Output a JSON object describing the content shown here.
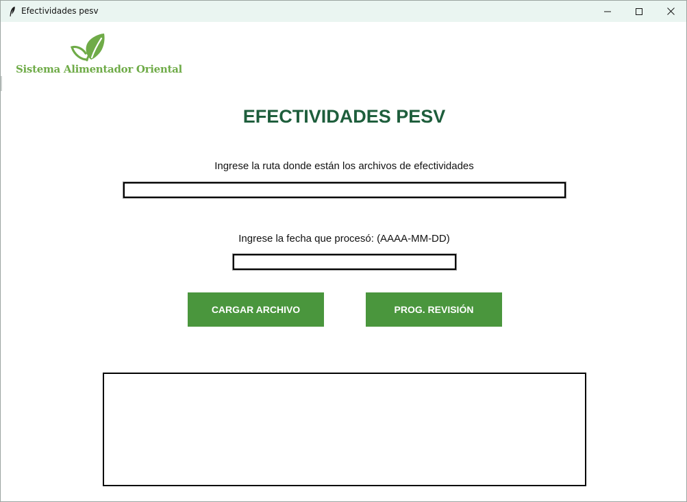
{
  "window": {
    "title": "Efectividades pesv",
    "controls": {
      "minimize_icon": "minimize-icon",
      "maximize_icon": "maximize-icon",
      "close_icon": "close-icon"
    }
  },
  "logo": {
    "text": "Sistema Alimentador Oriental",
    "icon": "leaf-icon",
    "color": "#6fab48"
  },
  "main": {
    "title": "EFECTIVIDADES PESV",
    "title_color": "#1e5e3c",
    "ruta": {
      "label": "Ingrese la ruta donde están los archivos de efectividades",
      "value": ""
    },
    "fecha": {
      "label": "Ingrese la fecha que procesó: (AAAA-MM-DD)",
      "value": ""
    },
    "buttons": {
      "cargar": "CARGAR ARCHIVO",
      "prog": "PROG. REVISIÓN",
      "color": "#4a963d"
    },
    "output": ""
  }
}
